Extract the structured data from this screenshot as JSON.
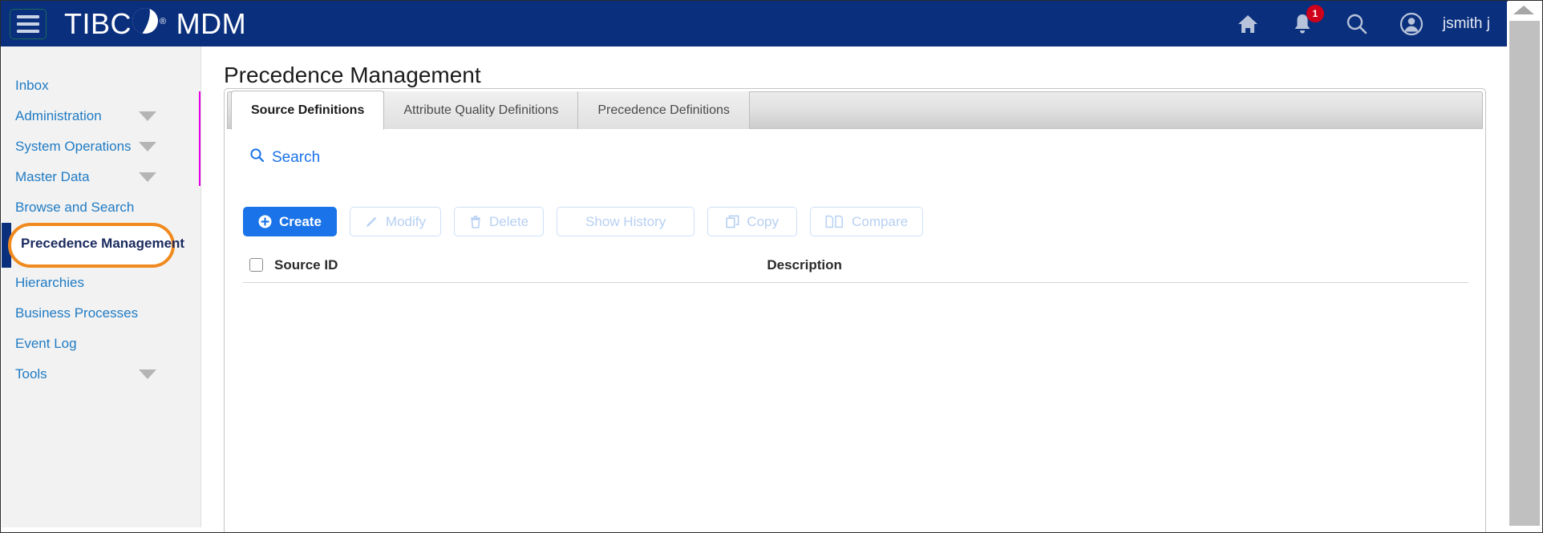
{
  "header": {
    "menu_icon": "hamburger-menu-icon",
    "brand_first": "TIBC",
    "brand_reg": "®",
    "brand_second": "MDM",
    "home_icon": "home-icon",
    "notifications_icon": "bell-icon",
    "notification_count": "1",
    "search_icon": "search-icon",
    "account_icon": "account-circle-icon",
    "username": "jsmith j",
    "bg_color": "#0a2f7d"
  },
  "sidebar": {
    "items": [
      {
        "label": "Inbox",
        "has_caret": false,
        "selected": false
      },
      {
        "label": "Administration",
        "has_caret": true,
        "selected": false
      },
      {
        "label": "System Operations",
        "has_caret": true,
        "selected": false
      },
      {
        "label": "Master Data",
        "has_caret": true,
        "selected": false
      },
      {
        "label": "Browse and Search",
        "has_caret": false,
        "selected": false
      },
      {
        "label": "Precedence Management",
        "has_caret": false,
        "selected": true
      },
      {
        "label": "Hierarchies",
        "has_caret": false,
        "selected": false
      },
      {
        "label": "Business Processes",
        "has_caret": false,
        "selected": false
      },
      {
        "label": "Event Log",
        "has_caret": false,
        "selected": false
      },
      {
        "label": "Tools",
        "has_caret": true,
        "selected": false
      }
    ],
    "highlight_color": "#f08a1e",
    "accent_color": "#0a2f7d",
    "marker_color": "#e600e6"
  },
  "main": {
    "page_title": "Precedence Management",
    "tabs": [
      {
        "label": "Source Definitions",
        "active": true
      },
      {
        "label": "Attribute Quality Definitions",
        "active": false
      },
      {
        "label": "Precedence Definitions",
        "active": false
      }
    ],
    "search_label": "Search",
    "search_icon": "search-icon",
    "buttons": [
      {
        "label": "Create",
        "icon": "plus-circle-icon",
        "state": "primary"
      },
      {
        "label": "Modify",
        "icon": "pencil-icon",
        "state": "disabled"
      },
      {
        "label": "Delete",
        "icon": "trash-icon",
        "state": "disabled"
      },
      {
        "label": "Show History",
        "icon": "none",
        "state": "disabled"
      },
      {
        "label": "Copy",
        "icon": "copy-icon",
        "state": "disabled"
      },
      {
        "label": "Compare",
        "icon": "compare-pages-icon",
        "state": "disabled"
      }
    ],
    "table": {
      "select_all_checkbox": "select-all",
      "columns": [
        "Source ID",
        "Description"
      ],
      "rows": []
    },
    "primary_color": "#1a73e8"
  },
  "scrollbar": {
    "up_arrow_icon": "chevron-up-icon"
  }
}
